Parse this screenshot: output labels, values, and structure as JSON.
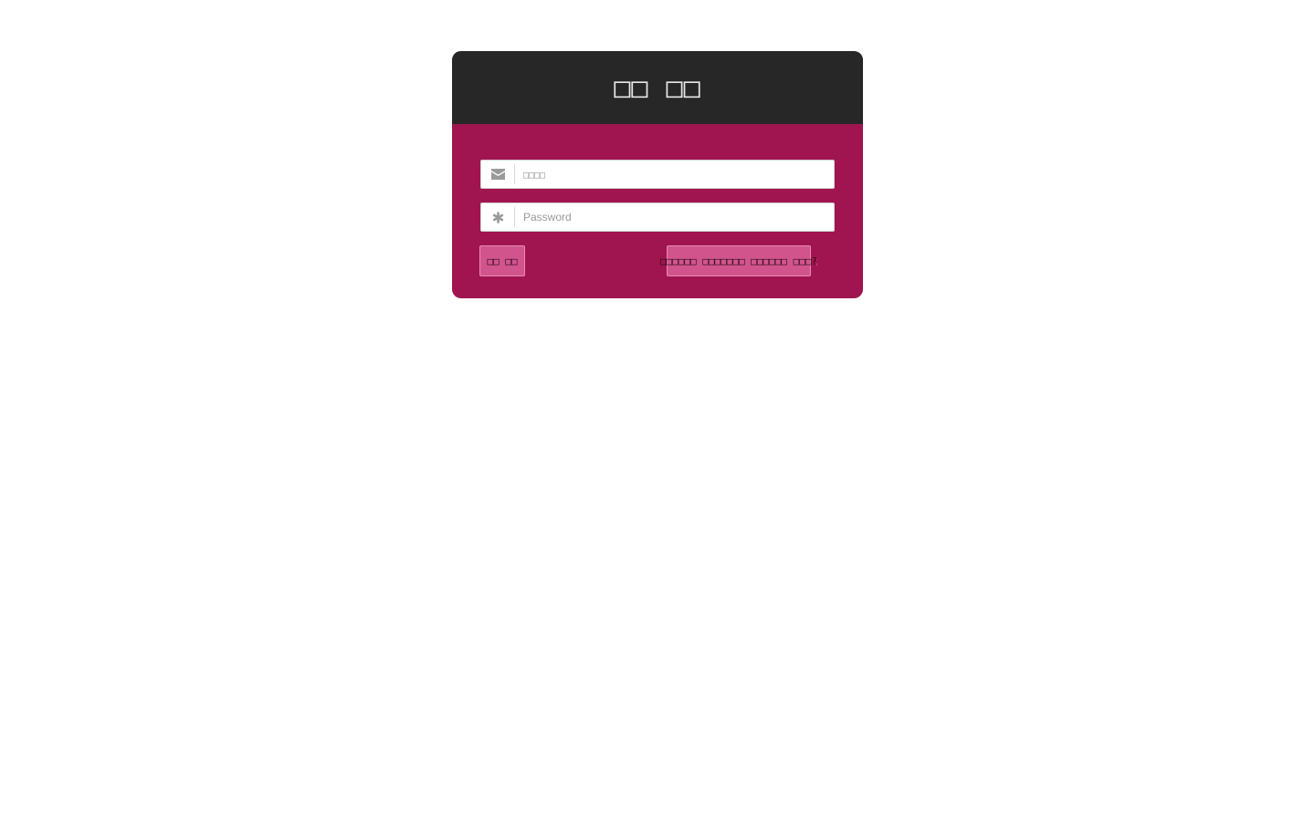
{
  "header": {
    "title": "□□ □□"
  },
  "form": {
    "email": {
      "icon": "envelope-icon",
      "value": "",
      "placeholder": "□□□□"
    },
    "password": {
      "icon": "asterisk-icon",
      "value": "",
      "placeholder": "Password"
    },
    "login_label": "□□ □□",
    "forgot_label": "□□□□□□ □□□□□□□ □□□□□□ □□□?",
    "trailing_mark": ";"
  },
  "colors": {
    "header_bg": "#272727",
    "body_bg": "#a0154f",
    "button_bg": "#d2548d"
  }
}
